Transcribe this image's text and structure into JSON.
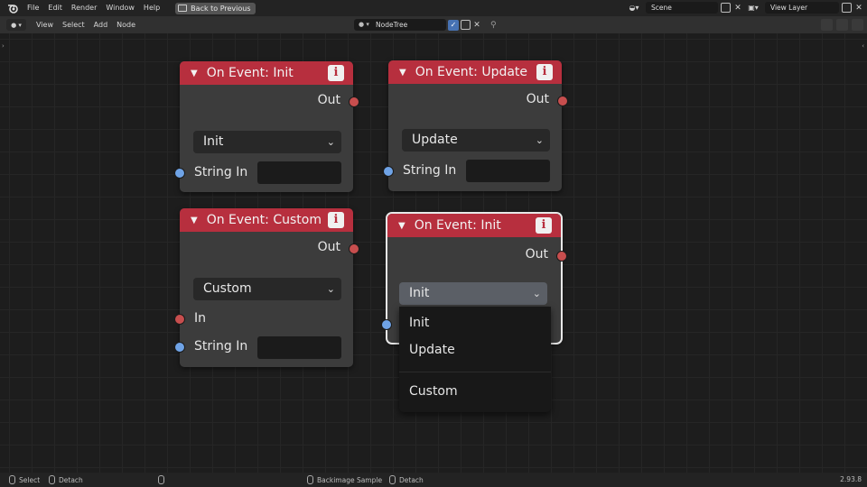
{
  "topbar": {
    "menus": [
      "File",
      "Edit",
      "Render",
      "Window",
      "Help"
    ],
    "back_button": "Back to Previous",
    "scene": "Scene",
    "view_layer": "View Layer"
  },
  "header": {
    "menus": [
      "View",
      "Select",
      "Add",
      "Node"
    ],
    "node_tree": "NodeTree"
  },
  "nodes": [
    {
      "title": "On Event: Init",
      "out_label": "Out",
      "dropdown_value": "Init",
      "inputs": [
        "String In"
      ]
    },
    {
      "title": "On Event: Update",
      "out_label": "Out",
      "dropdown_value": "Update",
      "inputs": [
        "String In"
      ]
    },
    {
      "title": "On Event: Custom",
      "out_label": "Out",
      "dropdown_value": "Custom",
      "inputs": [
        "In",
        "String In"
      ]
    },
    {
      "title": "On Event: Init",
      "out_label": "Out",
      "dropdown_value": "Init",
      "selected": true,
      "dropdown_open": true
    }
  ],
  "popup": {
    "options": [
      "Init",
      "Update",
      "Custom"
    ]
  },
  "statusbar": {
    "select": "Select",
    "detach_left": "Detach",
    "backimage_sample": "Backimage Sample",
    "detach_right": "Detach",
    "version": "2.93.8"
  },
  "colors": {
    "node_header": "#b72f3e",
    "output_socket": "#c74e4e",
    "string_socket": "#6fa3e6"
  }
}
